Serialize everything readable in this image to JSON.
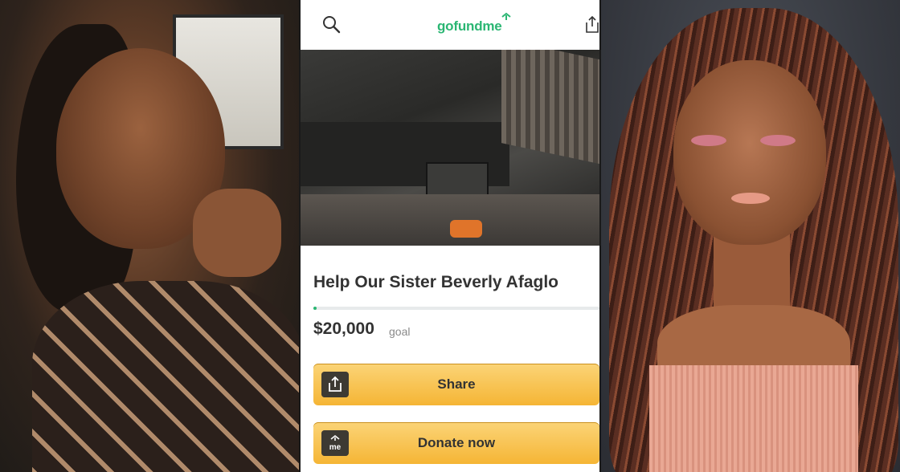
{
  "header": {
    "logo_text": "gofundme",
    "icons": [
      "search-icon",
      "share-icon"
    ]
  },
  "campaign": {
    "title": "Help Our Sister Beverly Afaglo",
    "goal_amount": "$20,000",
    "goal_label": "goal",
    "progress_fraction": 0.01
  },
  "actions": {
    "share_label": "Share",
    "donate_label": "Donate now"
  },
  "colors": {
    "brand_green": "#2bb673",
    "button_yellow": "#f5b535",
    "title_text": "#333333"
  }
}
